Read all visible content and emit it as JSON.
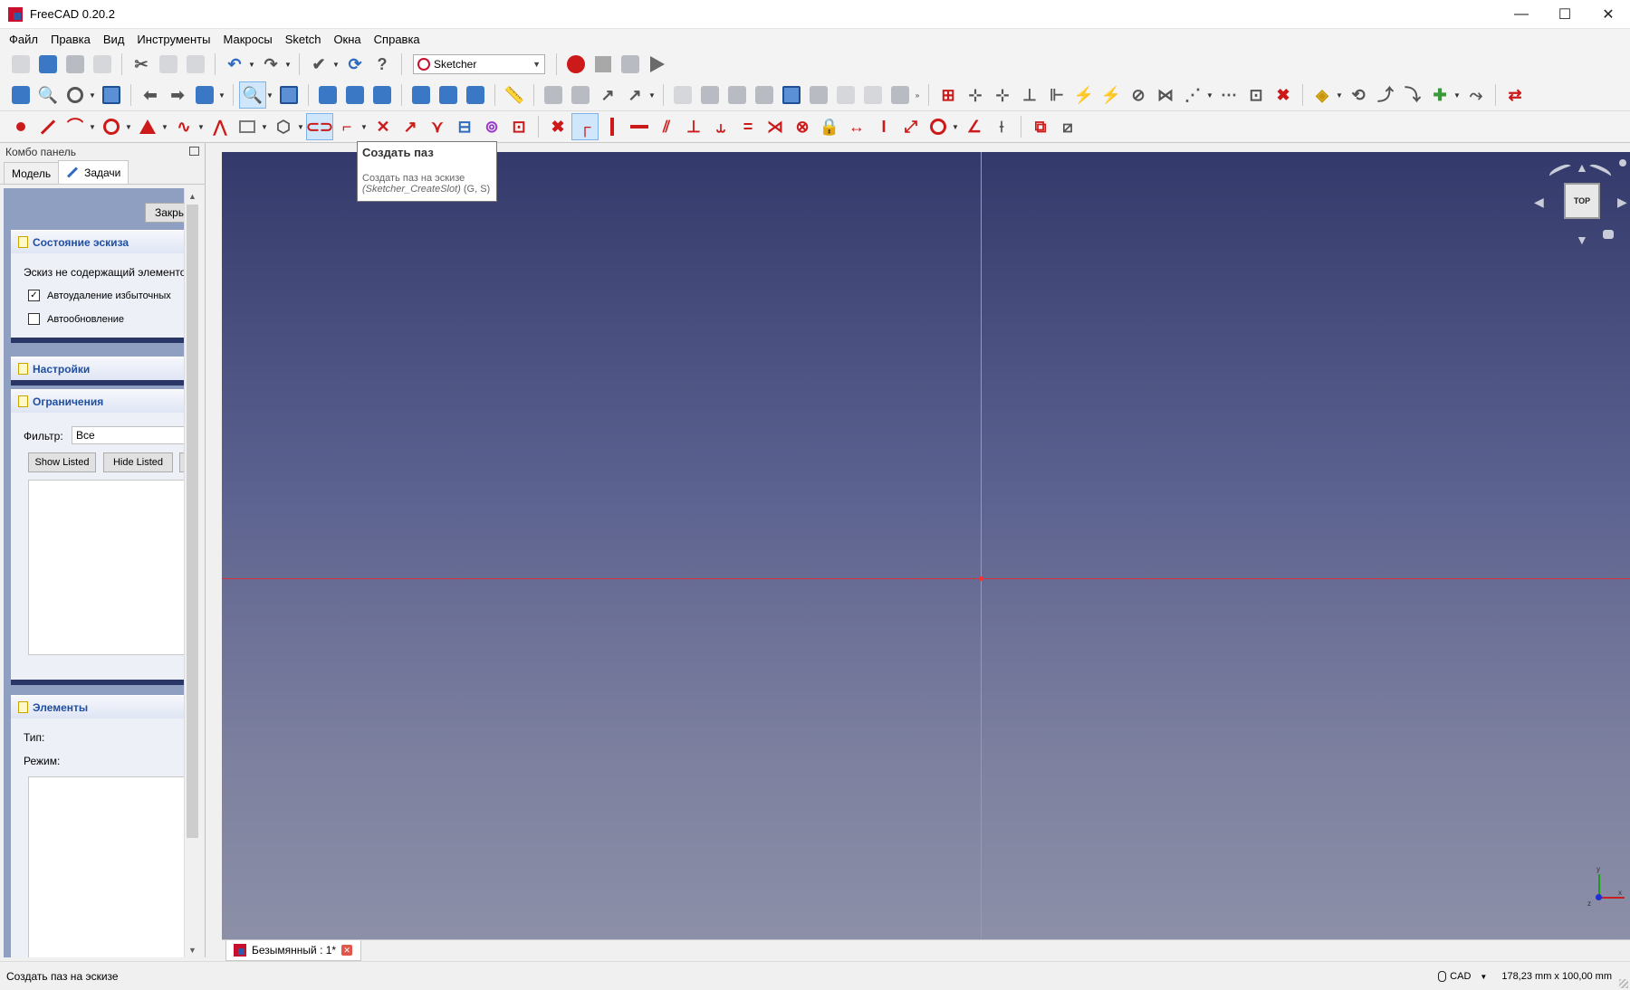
{
  "window": {
    "title": "FreeCAD 0.20.2",
    "controls": {
      "minimize": "—",
      "maximize": "☐",
      "close": "✕"
    }
  },
  "menubar": {
    "items": [
      "Файл",
      "Правка",
      "Вид",
      "Инструменты",
      "Макросы",
      "Sketch",
      "Окна",
      "Справка"
    ]
  },
  "toolbar": {
    "workbench_selected": "Sketcher"
  },
  "tooltip": {
    "title": "Создать паз",
    "description": "Создать паз на эскизе",
    "command": "(Sketcher_CreateSlot)",
    "shortcut": "(G, S)"
  },
  "combo": {
    "title": "Комбо панель",
    "tabs": [
      "Модель",
      "Задачи"
    ],
    "active_tab": "Задачи",
    "close_button": "Закрыть",
    "panels": {
      "sketch_state": {
        "title": "Состояние эскиза",
        "info": "Эскиз не содержащий элементов",
        "auto_remove": {
          "label": "Автоудаление избыточных",
          "checked": true
        },
        "auto_update": {
          "label": "Автообновление",
          "checked": false
        }
      },
      "settings": {
        "title": "Настройки"
      },
      "constraints": {
        "title": "Ограничения",
        "filter_label": "Фильтр:",
        "filter_value": "Все",
        "show_listed": "Show Listed",
        "hide_listed": "Hide Listed"
      },
      "elements": {
        "title": "Элементы",
        "type_label": "Тип:",
        "mode_label": "Режим:"
      }
    }
  },
  "view": {
    "navcube_face": "TOP",
    "axis_labels": {
      "x": "x",
      "y": "y",
      "z": "z"
    },
    "colors": {
      "x_axis": "#d8313a",
      "y_axis": "#3ce03c",
      "bg_top": "#33396a",
      "bg_bottom": "#9295ab"
    }
  },
  "document_tab": {
    "label": "Безымянный : 1*"
  },
  "statusbar": {
    "message": "Создать паз на эскизе",
    "navigation_style": "CAD",
    "dimensions": "178,23 mm x 100,00 mm"
  }
}
